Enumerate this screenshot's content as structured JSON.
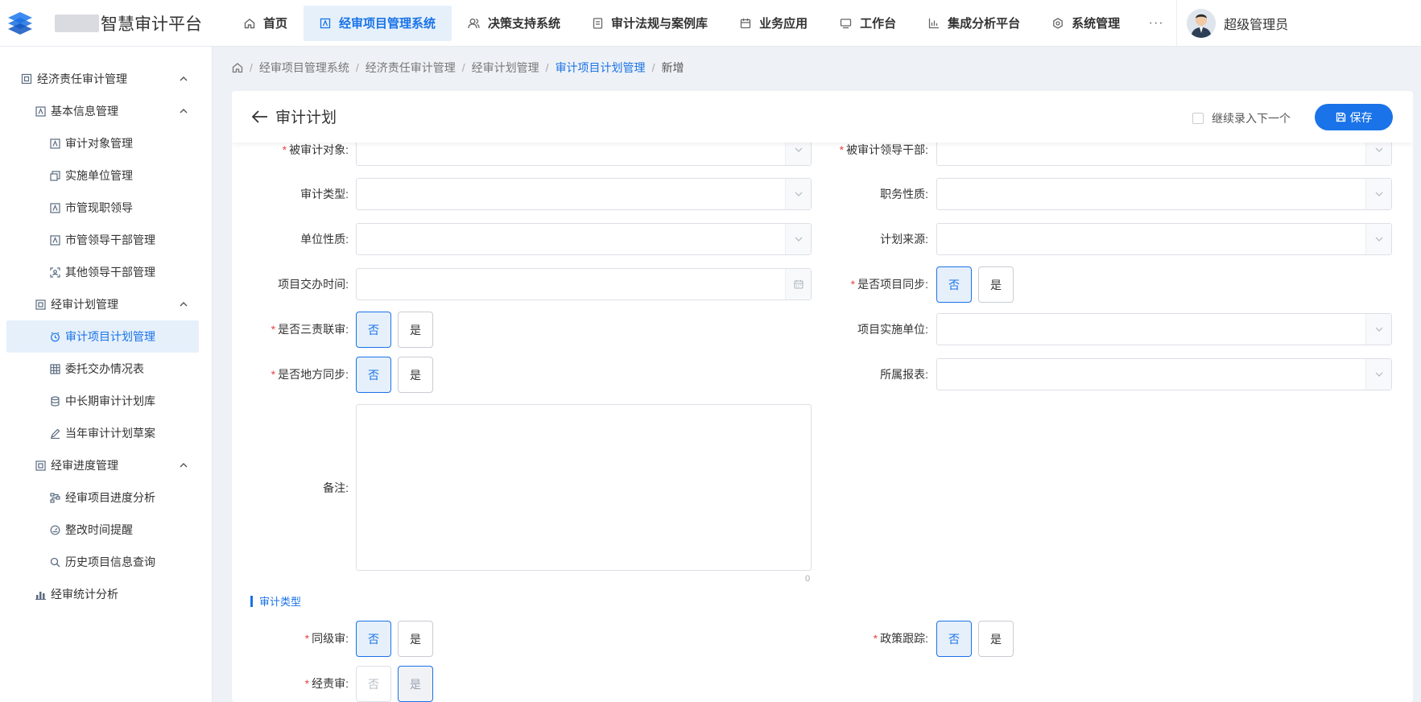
{
  "header": {
    "brand": "智慧审计平台",
    "nav": [
      {
        "label": "首页",
        "icon": "home-icon"
      },
      {
        "label": "经审项目管理系统",
        "icon": "project-icon",
        "active": true
      },
      {
        "label": "决策支持系统",
        "icon": "users-icon"
      },
      {
        "label": "审计法规与案例库",
        "icon": "document-icon"
      },
      {
        "label": "业务应用",
        "icon": "calendar-icon"
      },
      {
        "label": "工作台",
        "icon": "monitor-icon"
      },
      {
        "label": "集成分析平台",
        "icon": "chart-icon"
      },
      {
        "label": "系统管理",
        "icon": "gear-icon"
      }
    ],
    "more": "···",
    "user": "超级管理员"
  },
  "sidebar": {
    "items": [
      {
        "label": "经济责任审计管理",
        "level": 0,
        "icon": "module-icon",
        "chevron": true
      },
      {
        "label": "基本信息管理",
        "level": 1,
        "icon": "info-icon",
        "chevron": true
      },
      {
        "label": "审计对象管理",
        "level": 2,
        "icon": "target-icon"
      },
      {
        "label": "实施单位管理",
        "level": 2,
        "icon": "unit-icon"
      },
      {
        "label": "市管现职领导",
        "level": 2,
        "icon": "leader-icon"
      },
      {
        "label": "市管领导干部管理",
        "level": 2,
        "icon": "cadre-icon"
      },
      {
        "label": "其他领导干部管理",
        "level": 2,
        "icon": "person-icon"
      },
      {
        "label": "经审计划管理",
        "level": 1,
        "icon": "plan-icon",
        "chevron": true
      },
      {
        "label": "审计项目计划管理",
        "level": 2,
        "icon": "clock-icon",
        "active": true
      },
      {
        "label": "委托交办情况表",
        "level": 2,
        "icon": "grid-icon"
      },
      {
        "label": "中长期审计计划库",
        "level": 2,
        "icon": "database-icon"
      },
      {
        "label": "当年审计计划草案",
        "level": 2,
        "icon": "pen-icon"
      },
      {
        "label": "经审进度管理",
        "level": 1,
        "icon": "progress-icon",
        "chevron": true
      },
      {
        "label": "经审项目进度分析",
        "level": 2,
        "icon": "flow-icon"
      },
      {
        "label": "整改时间提醒",
        "level": 2,
        "icon": "gauge-icon"
      },
      {
        "label": "历史项目信息查询",
        "level": 2,
        "icon": "search-icon"
      },
      {
        "label": "经审统计分析",
        "level": 1,
        "icon": "bar-chart-icon"
      }
    ]
  },
  "breadcrumb": [
    "经审项目管理系统",
    "经济责任审计管理",
    "经审计划管理",
    "审计项目计划管理",
    "新增"
  ],
  "form": {
    "title": "审计计划",
    "continue_label": "继续录入下一个",
    "save_label": "保存",
    "fields": {
      "audit_target": "被审计对象:",
      "audited_leader": "被审计领导干部:",
      "audit_type": "审计类型:",
      "position_nature": "职务性质:",
      "unit_nature": "单位性质:",
      "plan_source": "计划来源:",
      "assign_time": "项目交办时间:",
      "project_sync": "是否项目同步:",
      "three_joint": "是否三责联审:",
      "impl_unit": "项目实施单位:",
      "local_sync": "是否地方同步:",
      "report": "所属报表:",
      "remark": "备注:"
    },
    "remark_count": "0",
    "section_title": "审计类型",
    "section_fields": {
      "same_level": "同级审:",
      "policy_track": "政策跟踪:",
      "econ_resp": "经责审:"
    },
    "no": "否",
    "yes": "是"
  }
}
